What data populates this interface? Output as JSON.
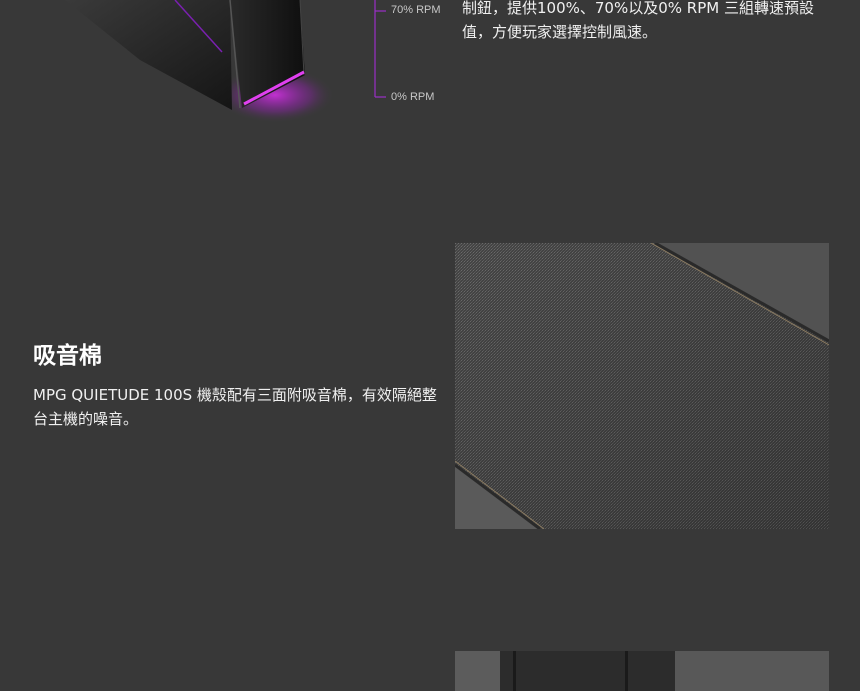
{
  "fan_diagram": {
    "label_70": "70% RPM",
    "label_0": "0% RPM",
    "accent_color": "#9b30c8"
  },
  "fan_control_text": "制鈕，提供100%、70%以及0% RPM 三組轉速預設值，方便玩家選擇控制風速。",
  "foam_section": {
    "title": "吸音棉",
    "description": "MPG QUIETUDE 100S 機殼配有三面附吸音棉，有效隔絕整台主機的噪音。"
  },
  "colors": {
    "background": "#383838",
    "text": "#ffffff",
    "rgb_glow": "#c020d0"
  }
}
